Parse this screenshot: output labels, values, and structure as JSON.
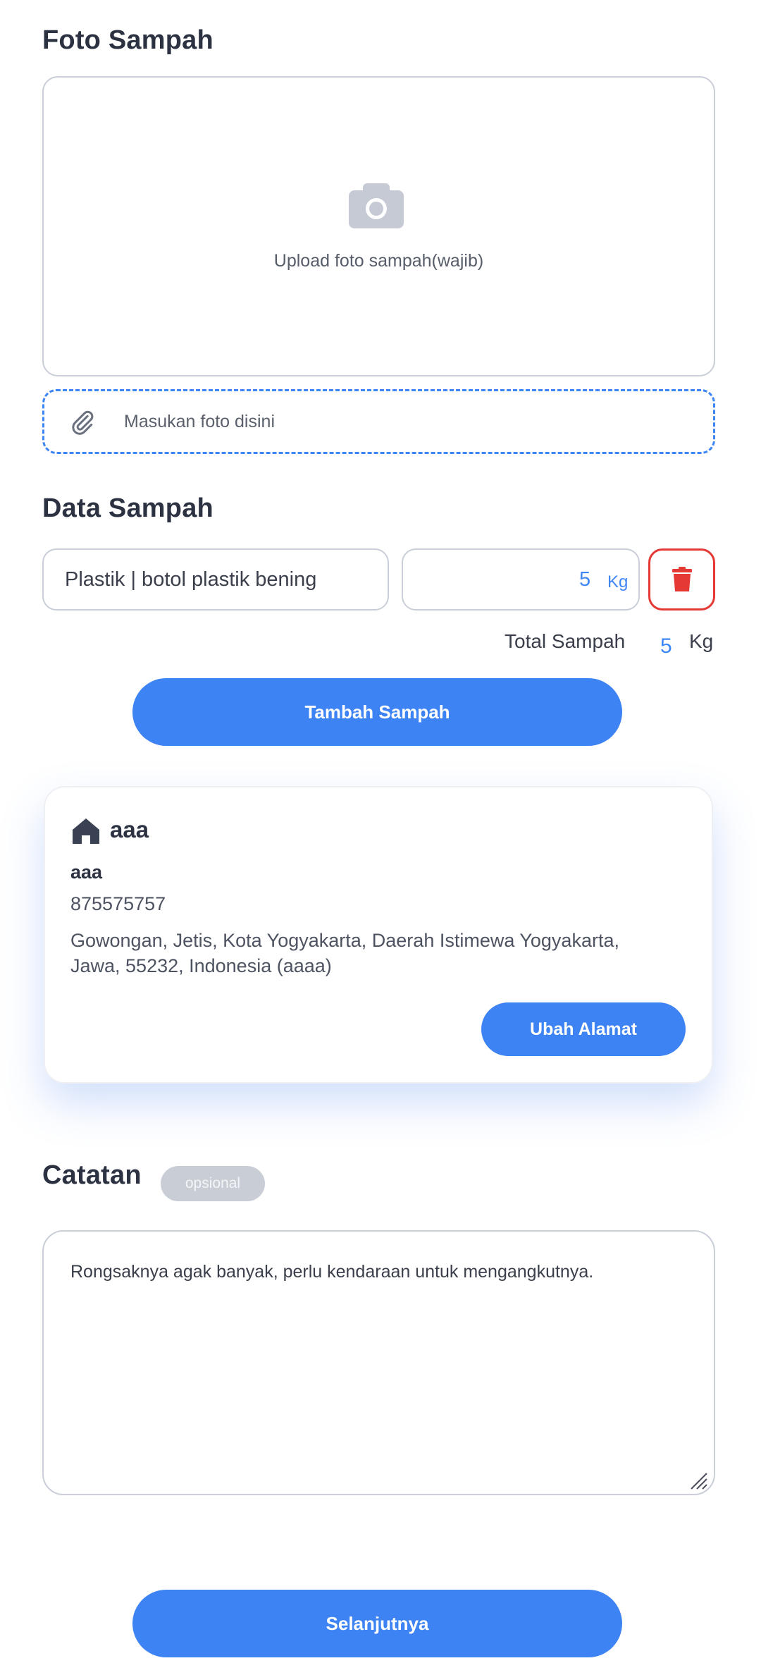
{
  "photo_section": {
    "title": "Foto Sampah",
    "upload_label": "Upload foto sampah(wajib)",
    "file_placeholder": "Masukan foto disini"
  },
  "waste_section": {
    "title": "Data Sampah",
    "items": [
      {
        "type": "Plastik | botol plastik bening",
        "weight": "5",
        "unit": "Kg"
      }
    ],
    "total_label": "Total Sampah",
    "total_value": "5",
    "total_unit": "Kg",
    "add_button": "Tambah Sampah"
  },
  "address": {
    "title": "aaa",
    "name": "aaa",
    "phone": "875575757",
    "full": "Gowongan, Jetis, Kota Yogyakarta, Daerah Istimewa Yogyakarta, Jawa, 55232, Indonesia (aaaa)",
    "change_button": "Ubah Alamat"
  },
  "notes_section": {
    "title": "Catatan",
    "badge": "opsional",
    "value": "Rongsaknya agak banyak, perlu kendaraan untuk mengangkutnya."
  },
  "next_button": "Selanjutnya",
  "colors": {
    "primary": "#3d83f4",
    "danger": "#e53935",
    "border": "#c9ced8"
  }
}
